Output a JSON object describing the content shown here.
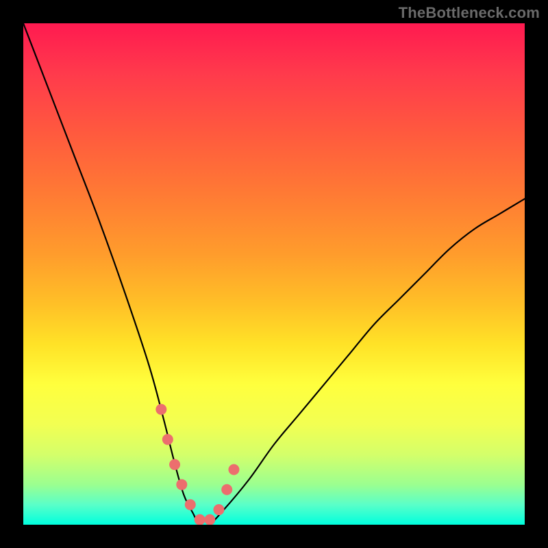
{
  "watermark": "TheBottleneck.com",
  "chart_data": {
    "type": "line",
    "title": "",
    "xlabel": "",
    "ylabel": "",
    "xlim": [
      0,
      100
    ],
    "ylim": [
      0,
      100
    ],
    "grid": false,
    "series": [
      {
        "name": "bottleneck-curve",
        "x": [
          0,
          5,
          10,
          15,
          20,
          25,
          28,
          30,
          32,
          34,
          35,
          37,
          40,
          45,
          50,
          55,
          60,
          65,
          70,
          75,
          80,
          85,
          90,
          95,
          100
        ],
        "values": [
          100,
          87,
          74,
          61,
          47,
          32,
          21,
          13,
          6,
          2,
          0,
          0,
          3,
          9,
          16,
          22,
          28,
          34,
          40,
          45,
          50,
          55,
          59,
          62,
          65
        ]
      }
    ],
    "highlight": {
      "name": "optimal-zone",
      "x": [
        27.5,
        28.8,
        30.2,
        31.6,
        33.3,
        35.2,
        37.2,
        39.0,
        40.6,
        42.0
      ],
      "values": [
        23,
        17,
        12,
        8,
        4,
        1,
        1,
        3,
        7,
        11
      ],
      "color": "#ec6e6e",
      "marker_size": 16
    },
    "gradient_stops": [
      {
        "pos": 0,
        "color": "#ff1a50"
      },
      {
        "pos": 34,
        "color": "#ff7a34"
      },
      {
        "pos": 64,
        "color": "#ffe227"
      },
      {
        "pos": 86,
        "color": "#d4ff6a"
      },
      {
        "pos": 100,
        "color": "#00ffde"
      }
    ]
  }
}
